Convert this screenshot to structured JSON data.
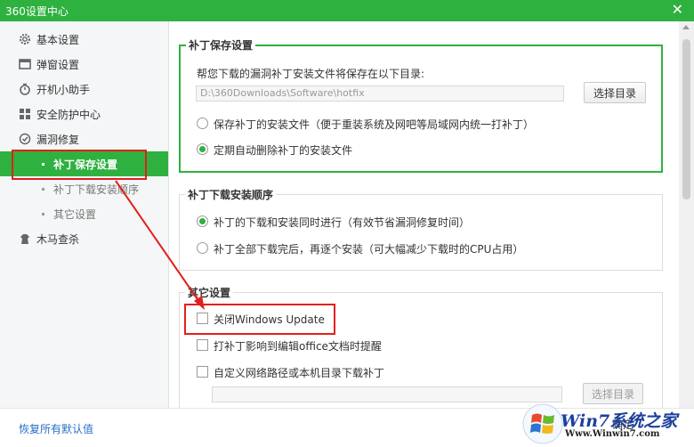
{
  "window": {
    "title": "360设置中心",
    "close_glyph": "✕"
  },
  "sidebar": {
    "items": [
      {
        "label": "基本设置",
        "icon": "gear-icon"
      },
      {
        "label": "弹窗设置",
        "icon": "window-icon"
      },
      {
        "label": "开机小助手",
        "icon": "timer-icon"
      },
      {
        "label": "安全防护中心",
        "icon": "grid-icon"
      },
      {
        "label": "漏洞修复",
        "icon": "patch-icon"
      },
      {
        "label": "木马查杀",
        "icon": "horse-icon"
      }
    ],
    "subitems": [
      {
        "label": "补丁保存设置",
        "active": true
      },
      {
        "label": "补丁下载安装顺序",
        "active": false
      },
      {
        "label": "其它设置",
        "active": false
      }
    ]
  },
  "patch_save": {
    "legend": "补丁保存设置",
    "description": "帮您下载的漏洞补丁安装文件将保存在以下目录:",
    "path_value": "D:\\360Downloads\\Software\\hotfix",
    "choose_dir_label": "选择目录",
    "options": [
      {
        "label": "保存补丁的安装文件（便于重装系统及网吧等局域网内统一打补丁）",
        "selected": false
      },
      {
        "label": "定期自动删除补丁的安装文件",
        "selected": true
      }
    ]
  },
  "install_order": {
    "legend": "补丁下载安装顺序",
    "options": [
      {
        "label": "补丁的下载和安装同时进行（有效节省漏洞修复时间）",
        "selected": true
      },
      {
        "label": "补丁全部下载完后，再逐个安装（可大幅减少下载时的CPU占用）",
        "selected": false
      }
    ]
  },
  "other": {
    "legend": "其它设置",
    "checks": [
      {
        "label": "关闭Windows Update",
        "checked": false
      },
      {
        "label": "打补丁影响到编辑office文档时提醒",
        "checked": false
      },
      {
        "label": "自定义网络路径或本机目录下载补丁",
        "checked": false
      }
    ],
    "custom_path_value": "",
    "choose_dir_label": "选择目录"
  },
  "footer": {
    "reset_label": "恢复所有默认值",
    "confirm_label": "确定"
  },
  "watermark": {
    "brand": "Win7系统之家",
    "url": "Www.Winwin7.com"
  },
  "colors": {
    "accent": "#2eb13f",
    "link": "#2a6fc6",
    "annotation": "#e0201b"
  }
}
